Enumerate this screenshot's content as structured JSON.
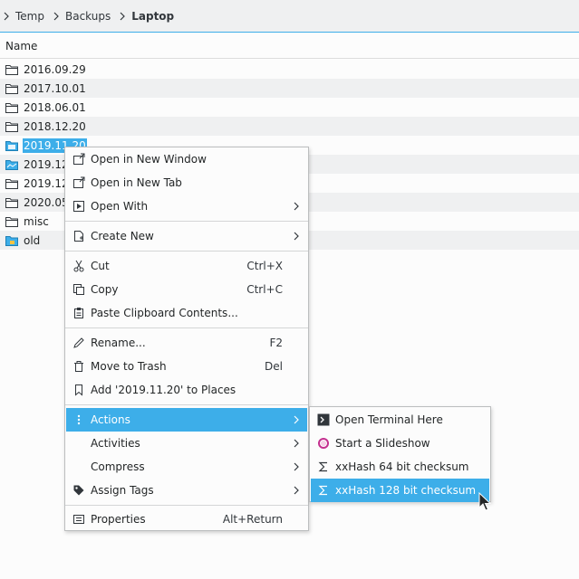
{
  "breadcrumb": [
    "Temp",
    "Backups",
    "Laptop"
  ],
  "header": {
    "name_column": "Name"
  },
  "files": [
    {
      "name": "2016.09.29",
      "icon": "folder-icon"
    },
    {
      "name": "2017.10.01",
      "icon": "folder-icon"
    },
    {
      "name": "2018.06.01",
      "icon": "folder-icon"
    },
    {
      "name": "2018.12.20",
      "icon": "folder-icon"
    },
    {
      "name": "2019.11.20",
      "icon": "folder-selected-icon",
      "selected": true
    },
    {
      "name": "2019.12.",
      "icon": "folder-blue-icon"
    },
    {
      "name": "2019.12.",
      "icon": "folder-icon"
    },
    {
      "name": "2020.05.",
      "icon": "folder-icon"
    },
    {
      "name": "misc",
      "icon": "folder-icon"
    },
    {
      "name": "old",
      "icon": "folder-locked-icon"
    }
  ],
  "menu": {
    "open_new_window": "Open in New Window",
    "open_new_tab": "Open in New Tab",
    "open_with": "Open With",
    "create_new": "Create New",
    "cut": "Cut",
    "cut_shortcut": "Ctrl+X",
    "copy": "Copy",
    "copy_shortcut": "Ctrl+C",
    "paste": "Paste Clipboard Contents...",
    "rename": "Rename...",
    "rename_shortcut": "F2",
    "trash": "Move to Trash",
    "trash_shortcut": "Del",
    "add_places": "Add '2019.11.20' to Places",
    "actions": "Actions",
    "activities": "Activities",
    "compress": "Compress",
    "assign_tags": "Assign Tags",
    "properties": "Properties",
    "properties_shortcut": "Alt+Return"
  },
  "submenu": {
    "terminal": "Open Terminal Here",
    "slideshow": "Start a Slideshow",
    "xxhash64": "xxHash 64 bit checksum",
    "xxhash128": "xxHash 128 bit checksum"
  },
  "colors": {
    "accent": "#3daee9",
    "text": "#232627",
    "alt_row": "#eff0f1"
  }
}
